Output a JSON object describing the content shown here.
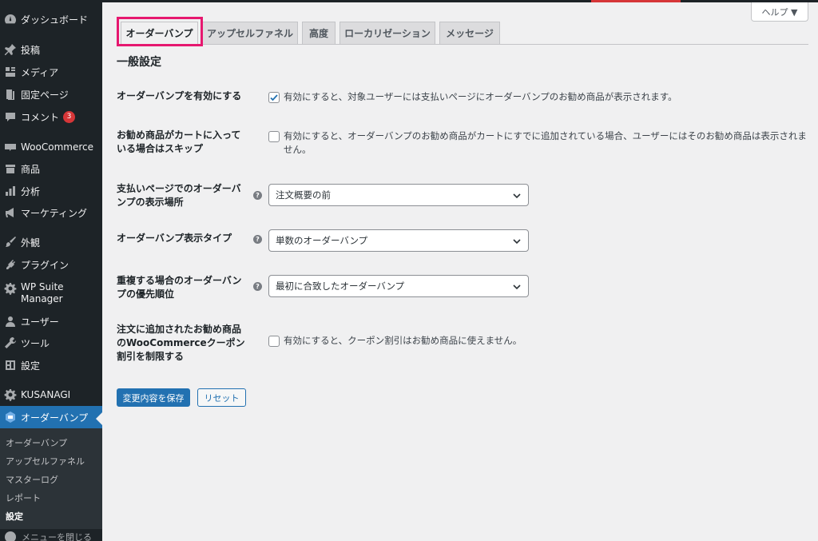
{
  "sidebar": {
    "items": [
      {
        "label": "ダッシュボード",
        "icon": "dashboard-icon"
      },
      {
        "label": "投稿",
        "icon": "pin-icon"
      },
      {
        "label": "メディア",
        "icon": "media-icon"
      },
      {
        "label": "固定ページ",
        "icon": "page-icon"
      },
      {
        "label": "コメント",
        "icon": "comment-icon",
        "badge": "3"
      },
      {
        "label": "WooCommerce",
        "icon": "woocommerce-icon"
      },
      {
        "label": "商品",
        "icon": "products-icon"
      },
      {
        "label": "分析",
        "icon": "analytics-icon"
      },
      {
        "label": "マーケティング",
        "icon": "megaphone-icon"
      },
      {
        "label": "外観",
        "icon": "brush-icon"
      },
      {
        "label": "プラグイン",
        "icon": "plugin-icon"
      },
      {
        "label": "WP Suite Manager",
        "icon": "gear-icon"
      },
      {
        "label": "ユーザー",
        "icon": "user-icon"
      },
      {
        "label": "ツール",
        "icon": "wrench-icon"
      },
      {
        "label": "設定",
        "icon": "settings-icon"
      },
      {
        "label": "KUSANAGI",
        "icon": "gear-icon"
      },
      {
        "label": "オーダーバンプ",
        "icon": "order-bump-icon"
      }
    ],
    "submenu": [
      "オーダーバンプ",
      "アップセルファネル",
      "マスターログ",
      "レポート",
      "設定"
    ],
    "collapse_label": "メニューを閉じる"
  },
  "help_button": "ヘルプ ▼",
  "tabs": [
    "オーダーバンプ",
    "アップセルファネル",
    "高度",
    "ローカリゼーション",
    "メッセージ"
  ],
  "section_title": "一般設定",
  "settings": {
    "enable_label": "オーダーバンプを有効にする",
    "enable_text": "有効にすると、対象ユーザーには支払いページにオーダーバンプのお勧め商品が表示されます。",
    "enable_checked": true,
    "skip_label": "お勧め商品がカートに入っている場合はスキップ",
    "skip_text": "有効にすると、オーダーバンプのお勧め商品がカートにすでに追加されている場合、ユーザーにはそのお勧め商品は表示されません。",
    "skip_checked": false,
    "location_label": "支払いページでのオーダーバンプの表示場所",
    "location_value": "注文概要の前",
    "type_label": "オーダーバンプ表示タイプ",
    "type_value": "単数のオーダーバンプ",
    "priority_label": "重複する場合のオーダーバンプの優先順位",
    "priority_value": "最初に合致したオーダーバンプ",
    "coupon_label": "注文に追加されたお勧め商品のWooCommerceクーポン割引を制限する",
    "coupon_text": "有効にすると、クーポン割引はお勧め商品に使えません。",
    "coupon_checked": false,
    "help_glyph": "?"
  },
  "buttons": {
    "save": "変更内容を保存",
    "reset": "リセット"
  },
  "colors": {
    "accent": "#2271b1",
    "highlight": "#e6186f",
    "badge": "#d63638"
  }
}
